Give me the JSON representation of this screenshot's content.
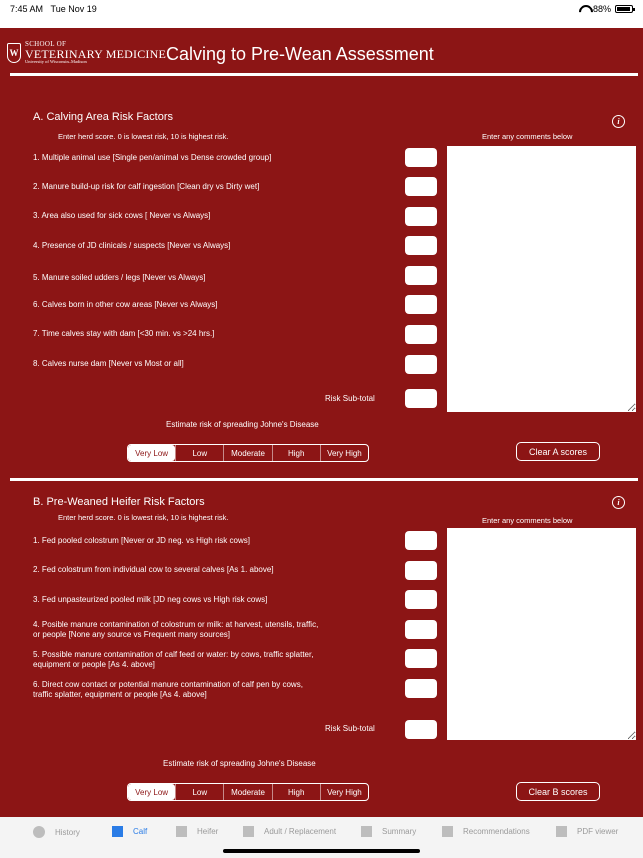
{
  "status": {
    "time": "7:45 AM",
    "date": "Tue Nov 19",
    "battery": "88%",
    "battery_level": 0.88
  },
  "header": {
    "logo_line1": "SCHOOL OF",
    "logo_line2": "VETERINARY MEDICINE",
    "logo_line3": "University of Wisconsin–Madison",
    "crest_letter": "W",
    "title": "Calving to Pre-Wean Assessment"
  },
  "sectionA": {
    "title": "A. Calving Area Risk Factors",
    "hint": "Enter herd score. 0 is lowest risk, 10 is highest risk.",
    "comments_hint": "Enter any comments below",
    "questions": [
      "1. Multiple animal use [Single pen/animal vs Dense crowded group]",
      "2. Manure build-up risk for calf ingestion [Clean dry vs Dirty wet]",
      "3. Area also used for sick cows [ Never vs Always]",
      "4. Presence of JD clinicals / suspects [Never vs Always]",
      "5. Manure soiled udders / legs [Never vs Always]",
      "6. Calves born in other cow areas [Never vs Always]",
      "7. Time calves stay with dam [<30 min. vs >24 hrs.]",
      "8. Calves nurse dam [Never vs Most or all]"
    ],
    "subtotal_label": "Risk Sub-total",
    "estimate_label": "Estimate risk of spreading Johne's Disease",
    "clear_label": "Clear A scores"
  },
  "sectionB": {
    "title": "B. Pre-Weaned Heifer Risk Factors",
    "hint": "Enter herd score. 0 is lowest risk, 10 is highest risk.",
    "comments_hint": "Enter any comments below",
    "questions": [
      "1. Fed pooled colostrum [Never or JD neg. vs High risk cows]",
      "2. Fed colostrum from individual cow to several calves [As 1. above]",
      "3. Fed unpasteurized pooled milk [JD neg cows vs High risk cows]",
      "4. Posible manure contamination of colostrum or milk: at harvest, utensils, traffic, or people [None any source vs Frequent many sources]",
      "5. Possible manure contamination of calf feed or water: by cows, traffic splatter, equipment or people [As 4. above]",
      "6. Direct cow contact or potential manure contamination of calf pen by cows, traffic splatter, equipment or people [As 4. above]"
    ],
    "subtotal_label": "Risk Sub-total",
    "estimate_label": "Estimate risk of spreading Johne's Disease",
    "clear_label": "Clear B scores"
  },
  "risk_levels": [
    "Very Low",
    "Low",
    "Moderate",
    "High",
    "Very High"
  ],
  "risk_selected_index": 0,
  "tabs": [
    {
      "label": "History",
      "icon": "circle-icon"
    },
    {
      "label": "Calf",
      "icon": "square-icon",
      "active": true
    },
    {
      "label": "Heifer",
      "icon": "square-icon"
    },
    {
      "label": "Adult / Replacement",
      "icon": "square-icon"
    },
    {
      "label": "Summary",
      "icon": "square-icon"
    },
    {
      "label": "Recommendations",
      "icon": "square-icon"
    },
    {
      "label": "PDF viewer",
      "icon": "square-icon"
    }
  ],
  "colors": {
    "brand": "#8c1515",
    "tab_active": "#2a7ce6",
    "tab_inactive": "#9a9a9a"
  }
}
